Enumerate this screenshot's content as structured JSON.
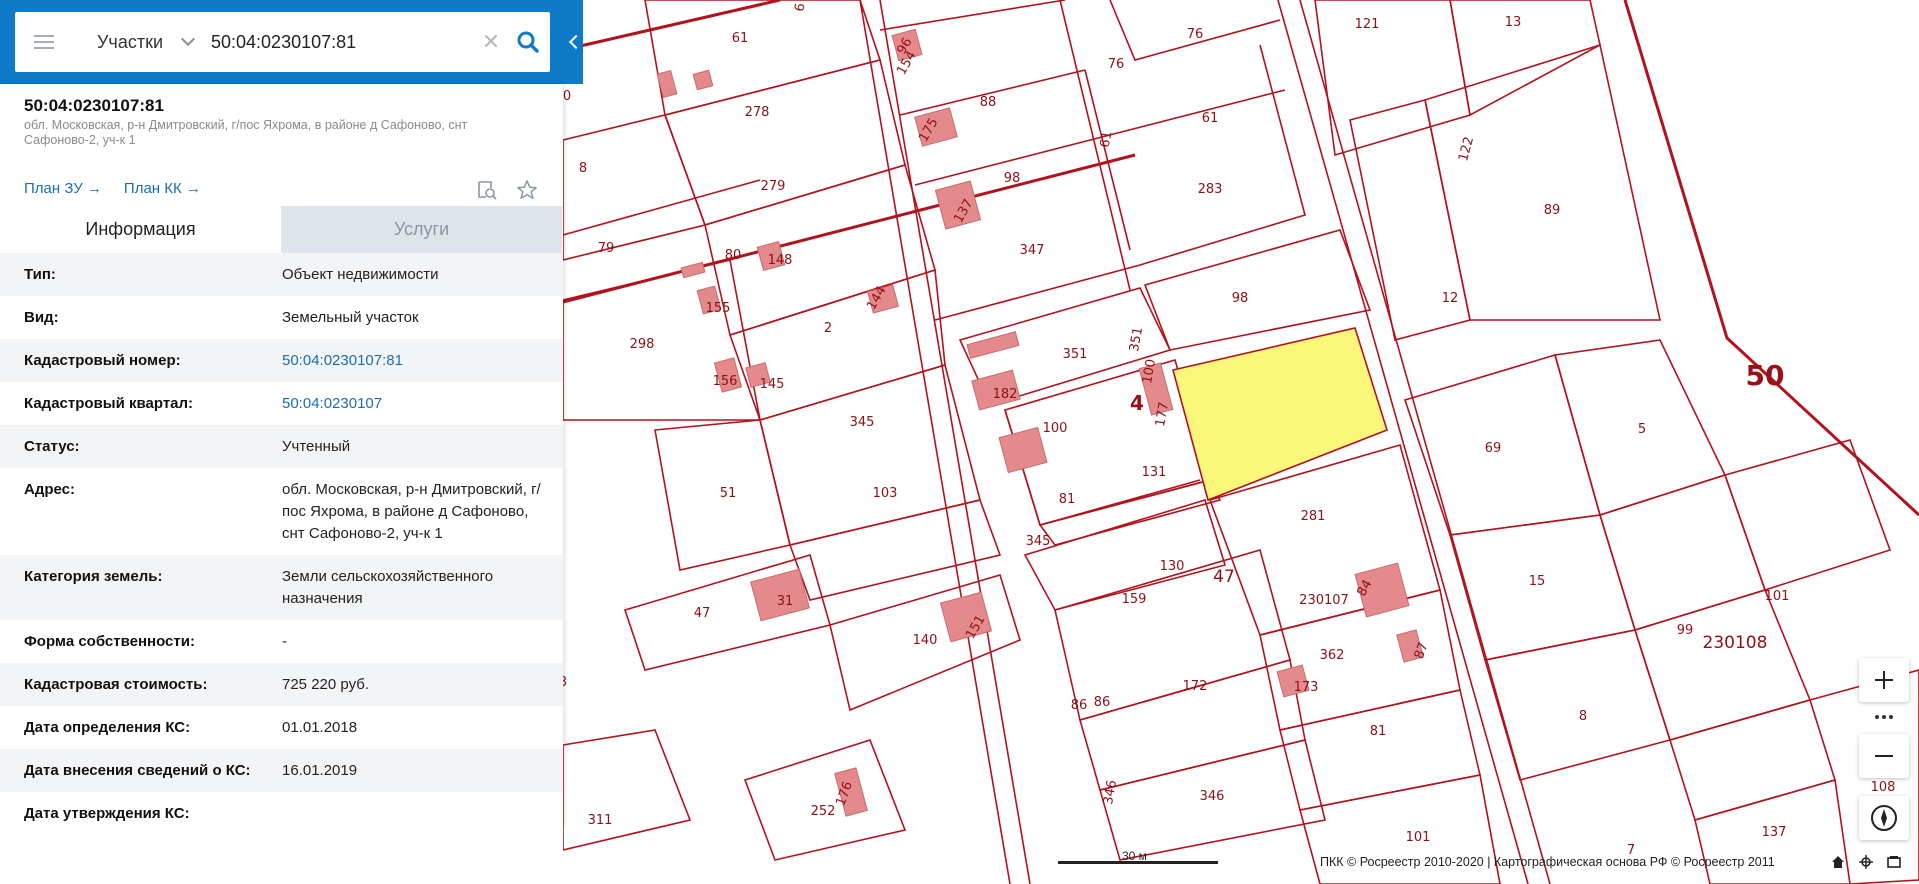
{
  "search": {
    "category": "Участки",
    "query": "50:04:0230107:81"
  },
  "object": {
    "title": "50:04:0230107:81",
    "address": "обл. Московская, р-н Дмитровский, г/пос Яхрома, в районе д Сафоново, снт Сафоново-2, уч-к 1",
    "links": [
      "План ЗУ",
      "План КК"
    ]
  },
  "tabs": [
    "Информация",
    "Услуги"
  ],
  "properties": [
    {
      "key": "Тип:",
      "value": "Объект недвижимости"
    },
    {
      "key": "Вид:",
      "value": "Земельный участок"
    },
    {
      "key": "Кадастровый номер:",
      "value": "50:04:0230107:81"
    },
    {
      "key": "Кадастровый квартал:",
      "value": "50:04:0230107"
    },
    {
      "key": "Статус:",
      "value": "Учтенный"
    },
    {
      "key": "Адрес:",
      "value": "обл. Московская, р-н Дмитровский, г/пос Яхрома, в районе д Сафоново, снт Сафоново-2, уч-к 1"
    },
    {
      "key": "Категория земель:",
      "value": "Земли сельскохозяйственного назначения"
    },
    {
      "key": "Форма собственности:",
      "value": "-"
    },
    {
      "key": "Кадастровая стоимость:",
      "value": "725 220 руб."
    },
    {
      "key": "Дата определения КС:",
      "value": "01.01.2018"
    },
    {
      "key": "Дата внесения сведений о КС:",
      "value": "16.01.2019"
    },
    {
      "key": "Дата утверждения КС:",
      "value": ""
    }
  ],
  "map": {
    "labels": [
      "61",
      "278",
      "279",
      "79",
      "80",
      "148",
      "155",
      "298",
      "156",
      "145",
      "2",
      "144",
      "96",
      "154",
      "175",
      "88",
      "137",
      "98",
      "347",
      "76",
      "61",
      "283",
      "61",
      "76",
      "121",
      "13",
      "122",
      "89",
      "12",
      "98",
      "351",
      "100",
      "177",
      "182",
      "351",
      "100",
      "131",
      "81",
      "345",
      "345",
      "51",
      "103",
      "281",
      "69",
      "5",
      "15",
      "130",
      "47",
      "230107",
      "84",
      "159",
      "47",
      "31",
      "151",
      "140",
      "362",
      "87",
      "172",
      "86",
      "173",
      "86",
      "81",
      "99",
      "101",
      "230108",
      "8",
      "346",
      "346",
      "252",
      "176",
      "311",
      "101",
      "7",
      "137",
      "108",
      "50",
      "4",
      "8",
      "6",
      "0",
      "3"
    ],
    "highlight_color": "#fbf77a",
    "line_color": "#b3121c"
  },
  "footer": {
    "scale": "30 м",
    "copyright": "ПКК © Росреестр 2010-2020 | Картографическая основа РФ © Росреестр 2011"
  }
}
